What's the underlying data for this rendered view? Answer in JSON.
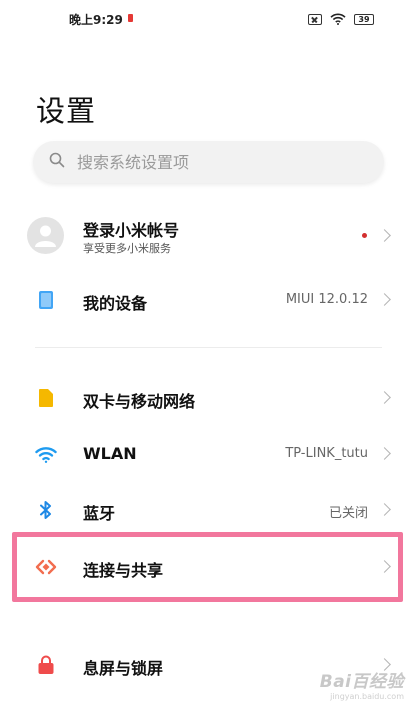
{
  "status_bar": {
    "time": "晚上9:29",
    "battery": "39",
    "icons": [
      "recording-indicator",
      "no-sim-icon",
      "wifi-icon",
      "battery-icon"
    ]
  },
  "page": {
    "title": "设置"
  },
  "search": {
    "placeholder": "搜索系统设置项",
    "icon": "search-icon"
  },
  "account": {
    "title": "登录小米帐号",
    "subtitle": "享受更多小米服务",
    "has_notification_dot": true
  },
  "items": [
    {
      "id": "my-device",
      "label": "我的设备",
      "value": "MIUI 12.0.12",
      "icon": "phone-icon",
      "color": "#42a5f5"
    },
    {
      "id": "dual-sim",
      "label": "双卡与移动网络",
      "value": "",
      "icon": "sim-icon",
      "color": "#f5b800"
    },
    {
      "id": "wlan",
      "label": "WLAN",
      "value": "TP-LINK_tutu",
      "icon": "wifi-icon",
      "color": "#1e9bf0"
    },
    {
      "id": "bluetooth",
      "label": "蓝牙",
      "value": "已关闭",
      "icon": "bluetooth-icon",
      "color": "#1e88e5"
    },
    {
      "id": "connection-share",
      "label": "连接与共享",
      "value": "",
      "icon": "connection-share-icon",
      "color": "#f26d4f"
    },
    {
      "id": "lock-screen",
      "label": "息屏与锁屏",
      "value": "",
      "icon": "lock-icon",
      "color": "#ef4b4b"
    }
  ],
  "watermark": {
    "main": "Bai百经验",
    "sub": "jingyan.baidu.com"
  },
  "colors": {
    "highlight_border": "#f2779d",
    "chevron": "#b5b5b5",
    "search_bg": "#f2f2f2"
  }
}
